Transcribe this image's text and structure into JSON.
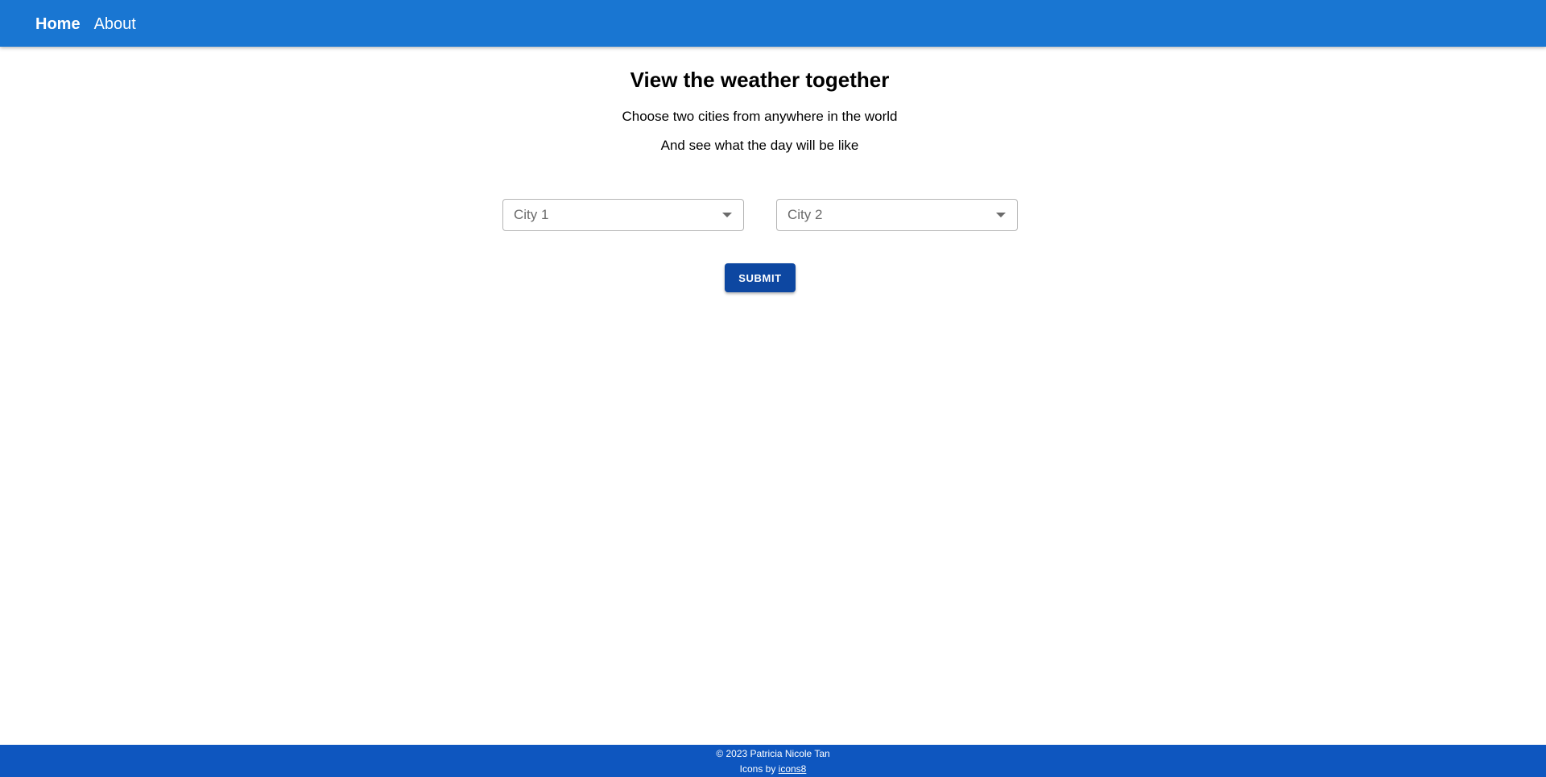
{
  "nav": {
    "home": "Home",
    "about": "About"
  },
  "hero": {
    "title": "View the weather together",
    "line1": "Choose two cities from anywhere in the world",
    "line2": "And see what the day will be like"
  },
  "form": {
    "city1_placeholder": "City 1",
    "city2_placeholder": "City 2",
    "submit_label": "SUBMIT"
  },
  "footer": {
    "copyright": "© 2023 Patricia Nicole Tan",
    "icons_prefix": "Icons by ",
    "icons_link": "icons8"
  },
  "colors": {
    "navbar": "#1976d2",
    "button": "#0d47a1",
    "footer": "#0e56bf"
  },
  "icons": {
    "dropdown": "caret-down-icon"
  }
}
